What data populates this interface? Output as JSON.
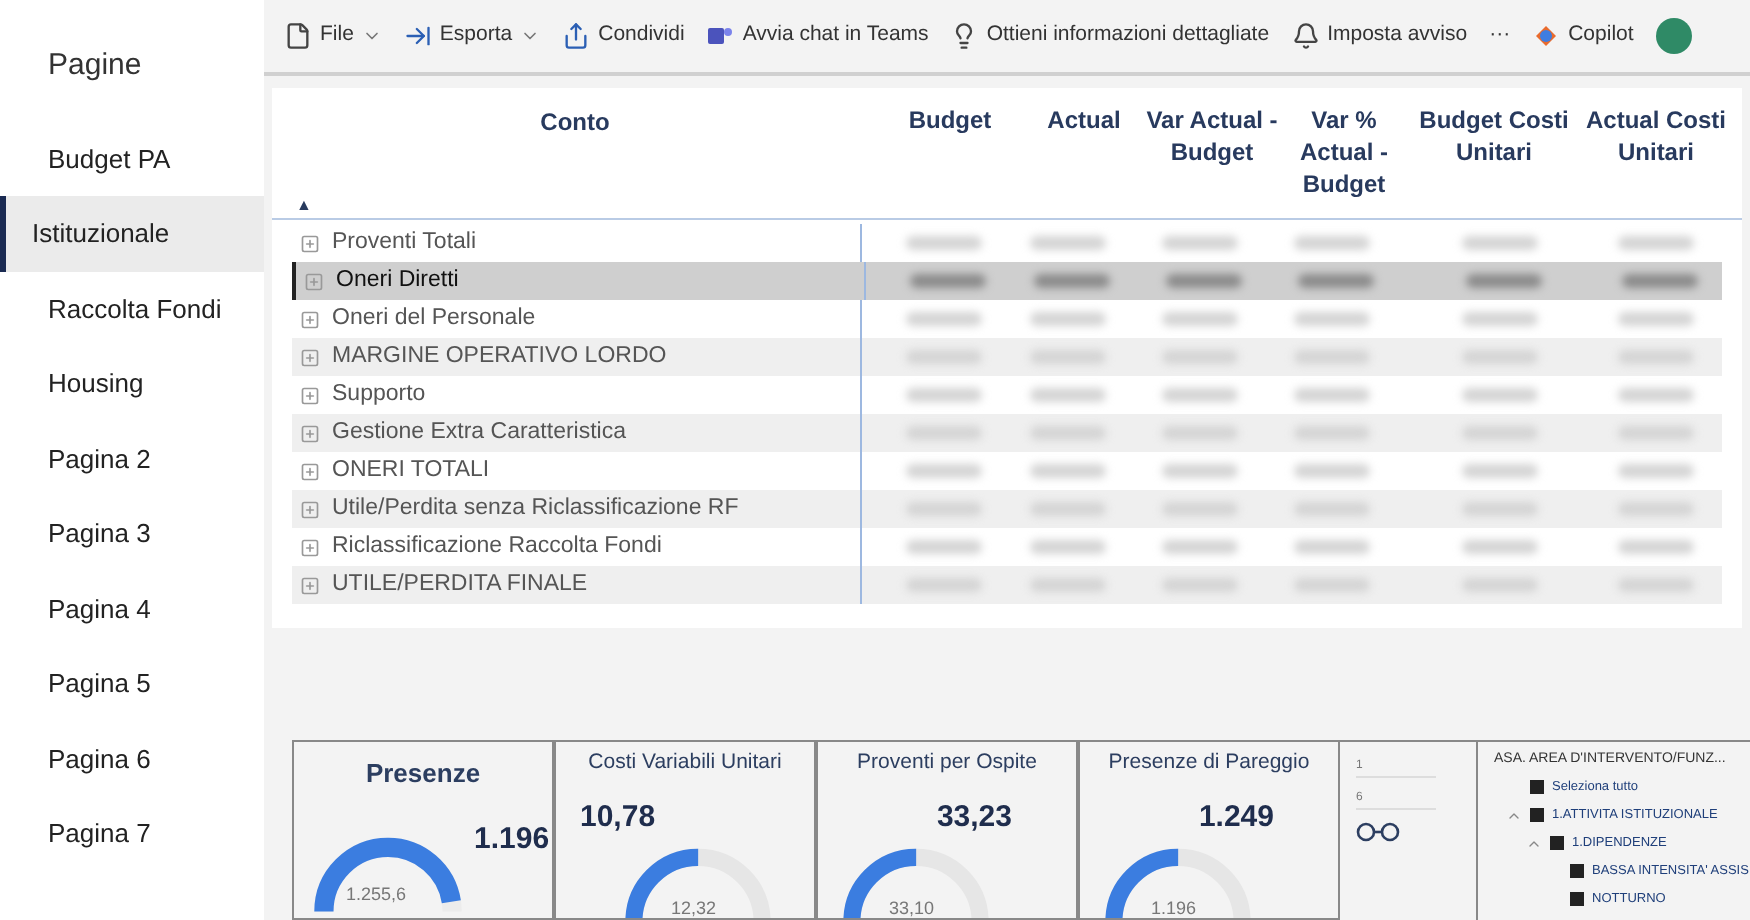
{
  "sidebar": {
    "title": "Pagine",
    "items": [
      {
        "label": "Budget PA",
        "selected": false
      },
      {
        "label": "Istituzionale",
        "selected": true
      },
      {
        "label": "Raccolta Fondi",
        "selected": false
      },
      {
        "label": "Housing",
        "selected": false
      },
      {
        "label": "Pagina 2",
        "selected": false
      },
      {
        "label": "Pagina 3",
        "selected": false
      },
      {
        "label": "Pagina 4",
        "selected": false
      },
      {
        "label": "Pagina 5",
        "selected": false
      },
      {
        "label": "Pagina 6",
        "selected": false
      },
      {
        "label": "Pagina 7",
        "selected": false
      }
    ]
  },
  "toolbar": [
    {
      "kind": "file",
      "label": "File",
      "dropdown": true
    },
    {
      "kind": "export",
      "label": "Esporta",
      "dropdown": true
    },
    {
      "kind": "share",
      "label": "Condividi",
      "dropdown": false
    },
    {
      "kind": "teams",
      "label": "Avvia chat in Teams",
      "dropdown": false
    },
    {
      "kind": "insight",
      "label": "Ottieni informazioni dettagliate",
      "dropdown": false
    },
    {
      "kind": "alert",
      "label": "Imposta avviso",
      "dropdown": false
    },
    {
      "kind": "more",
      "label": "···",
      "dropdown": false
    },
    {
      "kind": "copilot",
      "label": "Copilot",
      "dropdown": false
    }
  ],
  "table": {
    "columns": [
      "Conto",
      "Budget",
      "Actual",
      "Var Actual - Budget",
      "Var % Actual - Budget",
      "Budget Costi Unitari",
      "Actual Costi Unitari"
    ],
    "sort_indicator": "▲",
    "rows": [
      {
        "label": "Proventi Totali",
        "selected": false
      },
      {
        "label": "Oneri Diretti",
        "selected": true
      },
      {
        "label": "Oneri del Personale",
        "selected": false
      },
      {
        "label": "MARGINE OPERATIVO LORDO",
        "selected": false
      },
      {
        "label": "Supporto",
        "selected": false
      },
      {
        "label": "Gestione Extra Caratteristica",
        "selected": false
      },
      {
        "label": "ONERI TOTALI",
        "selected": false
      },
      {
        "label": "Utile/Perdita senza Riclassificazione RF",
        "selected": false
      },
      {
        "label": "Riclassificazione Raccolta Fondi",
        "selected": false
      },
      {
        "label": "UTILE/PERDITA FINALE",
        "selected": false
      }
    ]
  },
  "cards": [
    {
      "kind": "half",
      "title": "Presenze",
      "value": "1.196",
      "target": "1.255,6"
    },
    {
      "kind": "donut",
      "title": "Costi Variabili Unitari",
      "value": "10,78",
      "target": "12,32"
    },
    {
      "kind": "donut",
      "title": "Proventi per Ospite",
      "value": "33,23",
      "target": "33,10"
    },
    {
      "kind": "donut",
      "title": "Presenze di Pareggio",
      "value": "1.249",
      "target": "1.196"
    }
  ],
  "mini_panel": {
    "labels": [
      "1",
      "6"
    ]
  },
  "slicer": {
    "title": "ASA. AREA D'INTERVENTO/FUNZ...",
    "items": [
      {
        "label": "Seleziona tutto",
        "checked": true
      },
      {
        "label": "1.ATTIVITA ISTITUZIONALE",
        "checked": true,
        "expanded": true,
        "children": [
          {
            "label": "1.DIPENDENZE",
            "checked": true,
            "expanded": true,
            "children": [
              {
                "label": "BASSA INTENSITA' ASSIS",
                "checked": true
              },
              {
                "label": "NOTTURNO",
                "checked": true
              }
            ]
          }
        ]
      }
    ]
  }
}
